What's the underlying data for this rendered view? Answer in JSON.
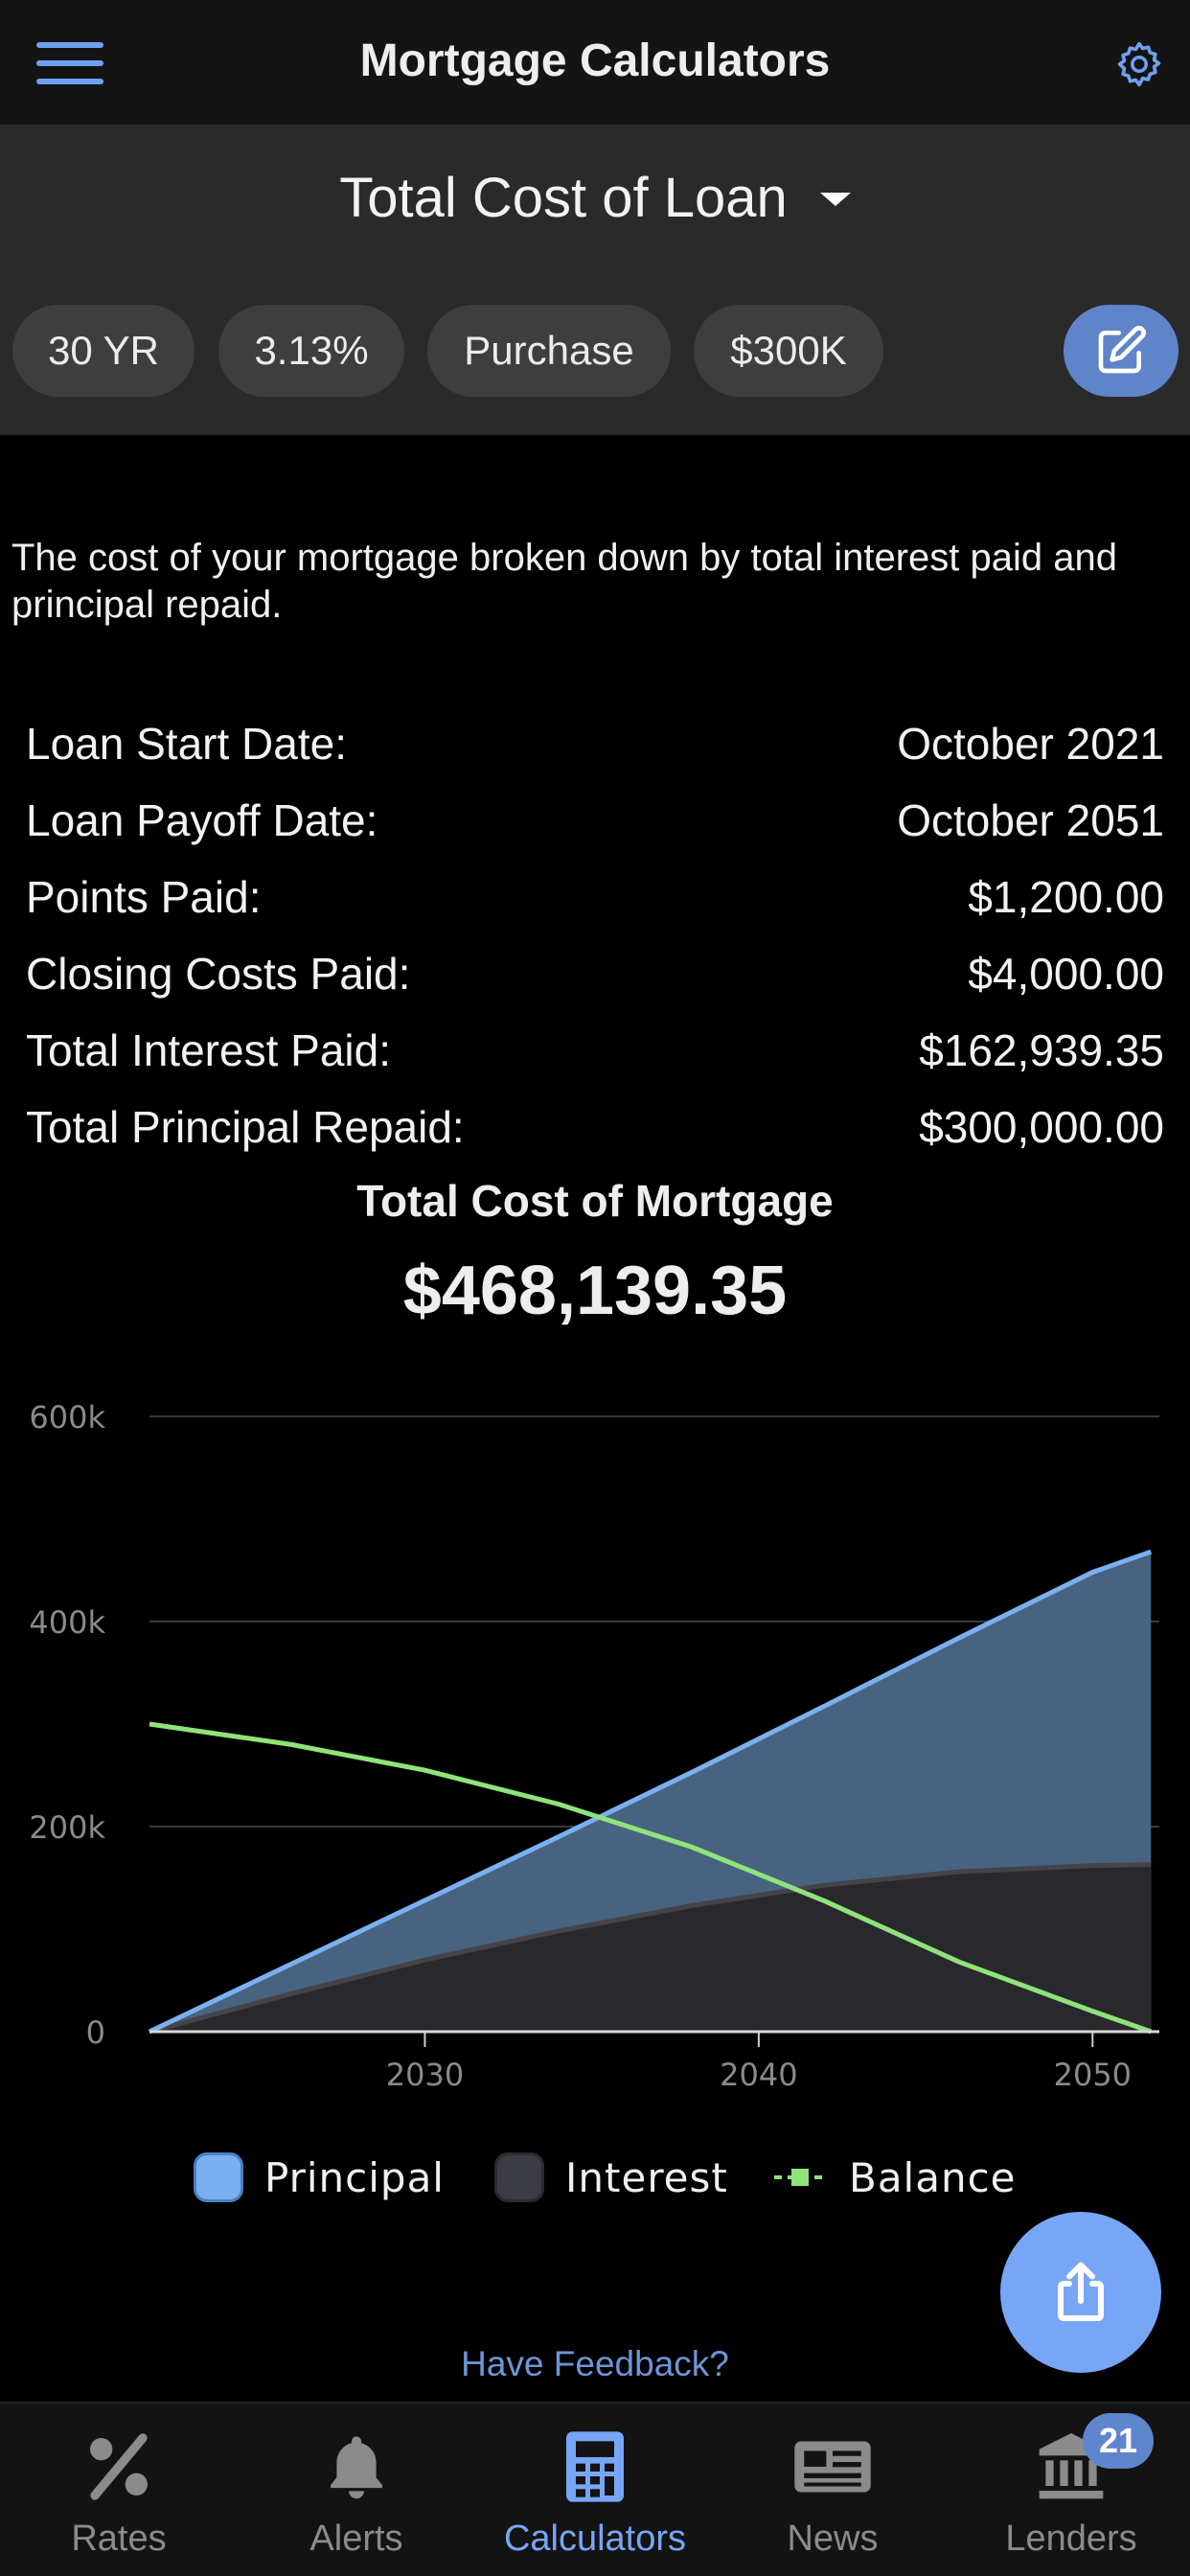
{
  "header": {
    "title": "Mortgage Calculators"
  },
  "calculator": {
    "selected": "Total Cost of Loan"
  },
  "chips": [
    "30 YR",
    "3.13%",
    "Purchase",
    "$300K"
  ],
  "description": "The cost of your mortgage broken down by total interest paid and principal repaid.",
  "summary": [
    {
      "label": "Loan Start Date:",
      "value": "October 2021"
    },
    {
      "label": "Loan Payoff Date:",
      "value": "October 2051"
    },
    {
      "label": "Points Paid:",
      "value": "$1,200.00"
    },
    {
      "label": "Closing Costs Paid:",
      "value": "$4,000.00"
    },
    {
      "label": "Total Interest Paid:",
      "value": "$162,939.35"
    },
    {
      "label": "Total Principal Repaid:",
      "value": "$300,000.00"
    }
  ],
  "total": {
    "label": "Total Cost of Mortgage",
    "value": "$468,139.35"
  },
  "chart_data": {
    "type": "area",
    "x_ticks": [
      "2030",
      "2040",
      "2050"
    ],
    "y_ticks": [
      "0",
      "200k",
      "400k",
      "600k"
    ],
    "ylim": [
      0,
      600000
    ],
    "xlim": [
      2021.75,
      2052
    ],
    "grid": true,
    "legend_position": "bottom",
    "x": [
      2021.75,
      2026,
      2030,
      2034,
      2038,
      2042,
      2046,
      2050,
      2051.75
    ],
    "series": [
      {
        "name": "Principal",
        "type": "area",
        "color": "#7ab0f0",
        "values": [
          0,
          66000,
          128000,
          190000,
          253000,
          318000,
          384000,
          448000,
          468000
        ]
      },
      {
        "name": "Interest",
        "type": "area",
        "color": "#3c3c44",
        "values": [
          0,
          37000,
          70000,
          98000,
          123000,
          143000,
          156000,
          162000,
          163000
        ]
      },
      {
        "name": "Balance",
        "type": "line",
        "color": "#8fe37a",
        "values": [
          300000,
          280000,
          255000,
          222000,
          180000,
          127000,
          68000,
          20000,
          0
        ]
      }
    ]
  },
  "feedback_label": "Have Feedback?",
  "nav": [
    {
      "label": "Rates",
      "icon": "percent-icon"
    },
    {
      "label": "Alerts",
      "icon": "bell-icon"
    },
    {
      "label": "Calculators",
      "icon": "calculator-icon",
      "active": true
    },
    {
      "label": "News",
      "icon": "newspaper-icon"
    },
    {
      "label": "Lenders",
      "icon": "bank-icon",
      "badge": "21"
    }
  ],
  "colors": {
    "accent": "#78a6f6",
    "principal": "#7ab0f0",
    "interest": "#3c3c44",
    "balance": "#8fe37a"
  }
}
